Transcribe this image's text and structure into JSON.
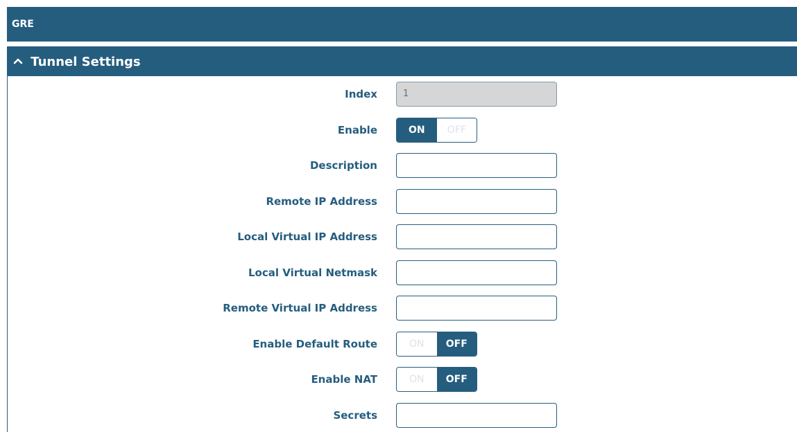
{
  "header": {
    "title": "GRE"
  },
  "section": {
    "title": "Tunnel Settings",
    "expanded": true
  },
  "fields": {
    "index": {
      "label": "Index",
      "value": "1"
    },
    "enable": {
      "label": "Enable",
      "on_label": "ON",
      "off_label": "OFF",
      "state": "on"
    },
    "description": {
      "label": "Description",
      "value": ""
    },
    "remote_ip": {
      "label": "Remote IP Address",
      "value": ""
    },
    "local_virtual_ip": {
      "label": "Local Virtual IP Address",
      "value": ""
    },
    "local_virtual_netmask": {
      "label": "Local Virtual Netmask",
      "value": ""
    },
    "remote_virtual_ip": {
      "label": "Remote Virtual IP Address",
      "value": ""
    },
    "enable_default_route": {
      "label": "Enable Default Route",
      "on_label": "ON",
      "off_label": "OFF",
      "state": "off"
    },
    "enable_nat": {
      "label": "Enable NAT",
      "on_label": "ON",
      "off_label": "OFF",
      "state": "off"
    },
    "secrets": {
      "label": "Secrets",
      "value": ""
    }
  },
  "colors": {
    "primary": "#255d7f",
    "readonly_bg": "#d6d6d6",
    "toggle_inactive_text": "#dde3e8"
  },
  "icons": {
    "collapse": "chevron-up-icon"
  }
}
